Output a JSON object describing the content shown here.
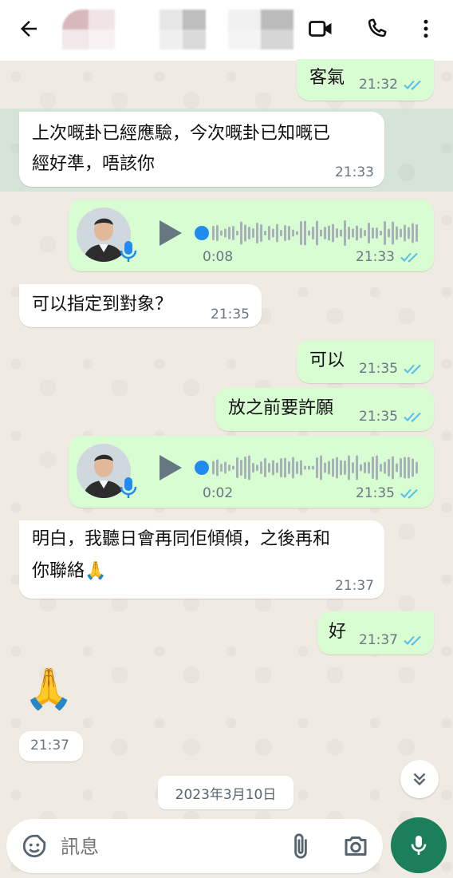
{
  "header": {
    "back_icon": "arrow-left-icon",
    "video_icon": "video-call-icon",
    "call_icon": "phone-icon",
    "menu_icon": "more-vert-icon"
  },
  "messages": [
    {
      "id": "m1",
      "direction": "out",
      "text": "客氣",
      "time": "21:32",
      "status": "read"
    },
    {
      "id": "m2",
      "direction": "in",
      "lines": [
        "上次嘅卦已經應驗，今次嘅卦已知嘅已",
        "經好準，唔該你"
      ],
      "time": "21:33",
      "highlighted": true
    },
    {
      "id": "m3",
      "direction": "out",
      "type": "voice",
      "duration": "0:08",
      "time": "21:33",
      "status": "read"
    },
    {
      "id": "m4",
      "direction": "in",
      "text": "可以指定到對象？",
      "time": "21:35"
    },
    {
      "id": "m5",
      "direction": "out",
      "text": "可以",
      "time": "21:35",
      "status": "read"
    },
    {
      "id": "m6",
      "direction": "out",
      "text": "放之前要許願",
      "time": "21:35",
      "status": "read"
    },
    {
      "id": "m7",
      "direction": "out",
      "type": "voice",
      "duration": "0:02",
      "time": "21:35",
      "status": "read"
    },
    {
      "id": "m8",
      "direction": "in",
      "lines": [
        "明白，我聽日會再同佢傾傾，之後再和",
        "你聯絡🙏"
      ],
      "time": "21:37"
    },
    {
      "id": "m9",
      "direction": "out",
      "text": "好",
      "time": "21:37",
      "status": "read"
    },
    {
      "id": "m10",
      "direction": "in",
      "type": "emoji",
      "text": "🙏",
      "time": "21:37"
    }
  ],
  "date_chip": "2023年3月10日",
  "composer": {
    "placeholder": "訊息",
    "emoji_icon": "sticker-smile-icon",
    "attach_icon": "paperclip-icon",
    "camera_icon": "camera-icon",
    "mic_icon": "mic-icon"
  },
  "colors": {
    "outgoing_bubble": "#d9fdd3",
    "incoming_bubble": "#ffffff",
    "read_tick": "#53bdeb",
    "accent": "#1a7f5a",
    "wallpaper": "#efeae2"
  }
}
